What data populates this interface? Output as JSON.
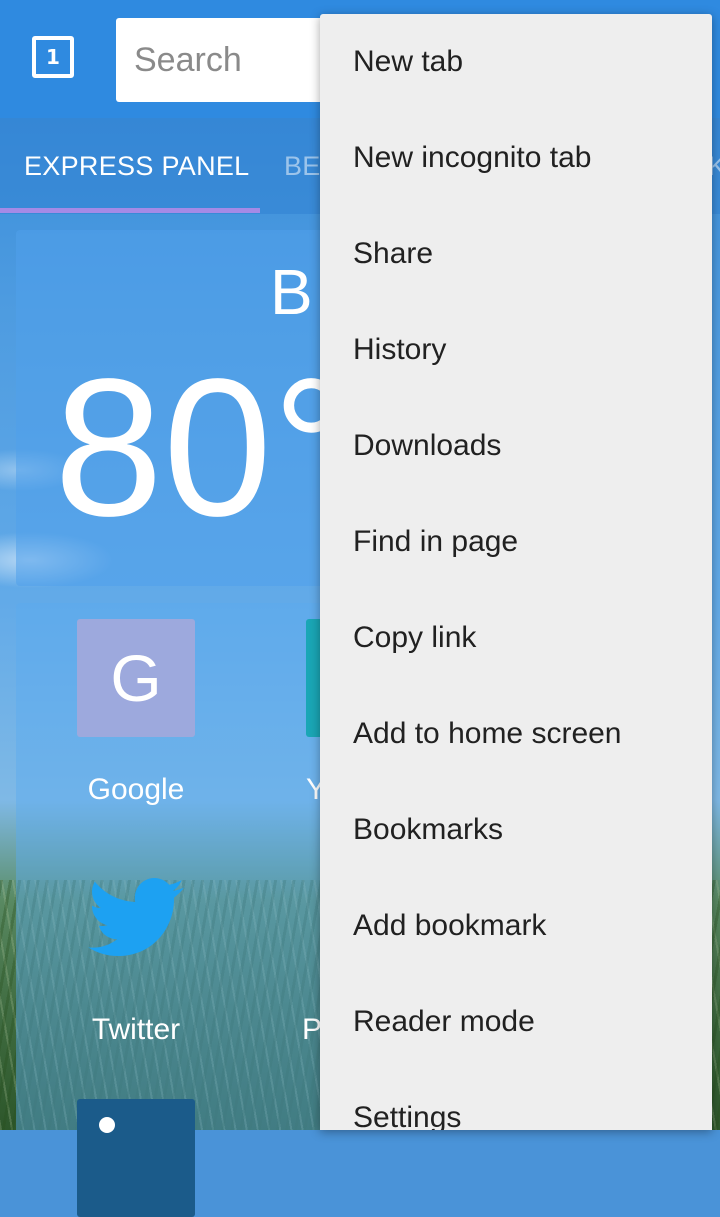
{
  "toolbar": {
    "tab_count": "1",
    "search_placeholder": "Search"
  },
  "tabs": [
    {
      "label": "EXPRESS PANEL",
      "active": true
    },
    {
      "label": "BE"
    },
    {
      "label": "K"
    }
  ],
  "weather": {
    "city_partial": "B",
    "temperature_partial": "80°"
  },
  "speed_dial": [
    {
      "label": "Google",
      "icon_letter": "G",
      "icon": "google-letter-icon"
    },
    {
      "label": "Y",
      "icon": "y-site-icon"
    },
    {
      "label": "Twitter",
      "icon": "twitter-bird-icon"
    },
    {
      "label": "P",
      "icon": "p-site-icon"
    }
  ],
  "menu": {
    "items": [
      "New tab",
      "New incognito tab",
      "Share",
      "History",
      "Downloads",
      "Find in page",
      "Copy link",
      "Add to home screen",
      "Bookmarks",
      "Add bookmark",
      "Reader mode",
      "Settings"
    ]
  },
  "colors": {
    "toolbar": "#2f8ae0",
    "tab_indicator": "#a58ae6",
    "menu_bg": "#eeeeee",
    "google_tile": "#9da9dd",
    "twitter_blue": "#1da1f2"
  }
}
